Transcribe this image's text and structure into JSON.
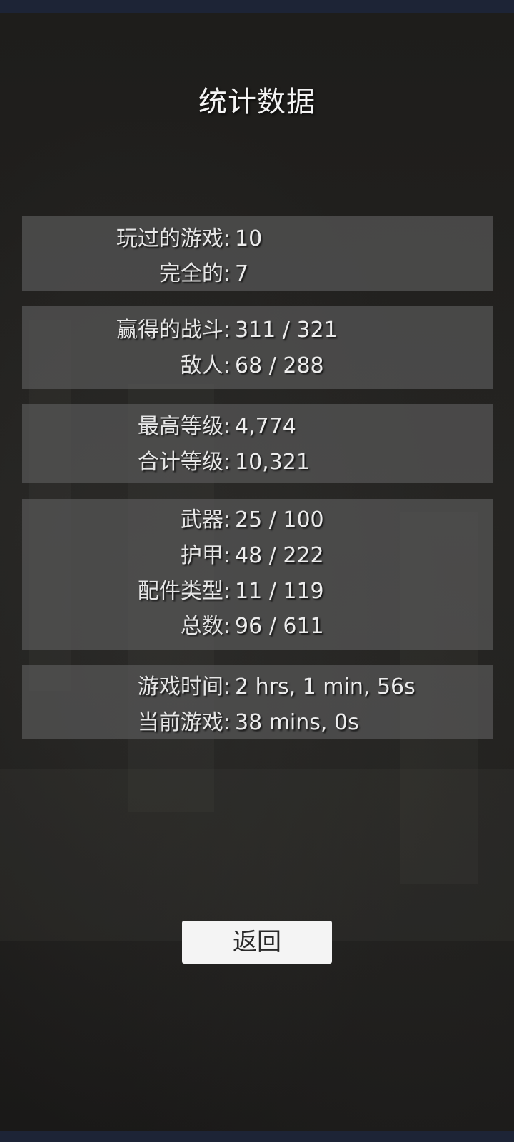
{
  "title": "统计数据",
  "groups": [
    {
      "rows": [
        {
          "label": "玩过的游戏:",
          "value": "10"
        },
        {
          "label": "完全的:",
          "value": "7"
        }
      ]
    },
    {
      "rows": [
        {
          "label": "赢得的战斗:",
          "value": "311 / 321"
        },
        {
          "label": "敌人:",
          "value": "68 / 288"
        }
      ]
    },
    {
      "rows": [
        {
          "label": "最高等级:",
          "value": "4,774"
        },
        {
          "label": "合计等级:",
          "value": "10,321"
        }
      ]
    },
    {
      "rows": [
        {
          "label": "武器:",
          "value": "25 / 100"
        },
        {
          "label": "护甲:",
          "value": "48 / 222"
        },
        {
          "label": "配件类型:",
          "value": "11 / 119"
        },
        {
          "label": "总数:",
          "value": "96 / 611"
        }
      ]
    },
    {
      "rows": [
        {
          "label": "游戏时间:",
          "value": "2 hrs, 1 min, 56s"
        },
        {
          "label": "当前游戏:",
          "value": "38 mins, 0s"
        }
      ]
    }
  ],
  "back_button": {
    "label": "返回"
  },
  "colors": {
    "background": "#1c1b19",
    "panel": "#585858",
    "system_bar": "#1d2436",
    "button": "#f4f4f4",
    "text": "#e8e8e8"
  }
}
